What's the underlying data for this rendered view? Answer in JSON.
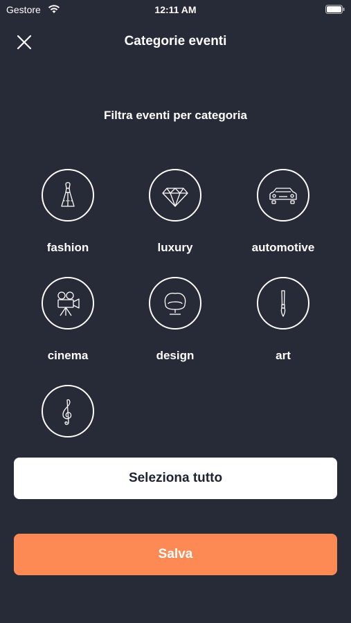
{
  "status_bar": {
    "carrier": "Gestore",
    "time": "12:11 AM"
  },
  "header": {
    "title": "Categorie eventi",
    "close_icon": "close-icon"
  },
  "subtitle": "Filtra eventi per categoria",
  "categories": [
    {
      "label": "fashion",
      "icon": "dress-icon"
    },
    {
      "label": "luxury",
      "icon": "diamond-icon"
    },
    {
      "label": "automotive",
      "icon": "car-icon"
    },
    {
      "label": "cinema",
      "icon": "movie-camera-icon"
    },
    {
      "label": "design",
      "icon": "armchair-icon"
    },
    {
      "label": "art",
      "icon": "paintbrush-icon"
    },
    {
      "label": "",
      "icon": "treble-clef-icon"
    }
  ],
  "buttons": {
    "select_all": "Seleziona tutto",
    "save": "Salva"
  },
  "colors": {
    "background": "#272a37",
    "accent": "#fd8a55",
    "select_button": "#ffffff"
  }
}
